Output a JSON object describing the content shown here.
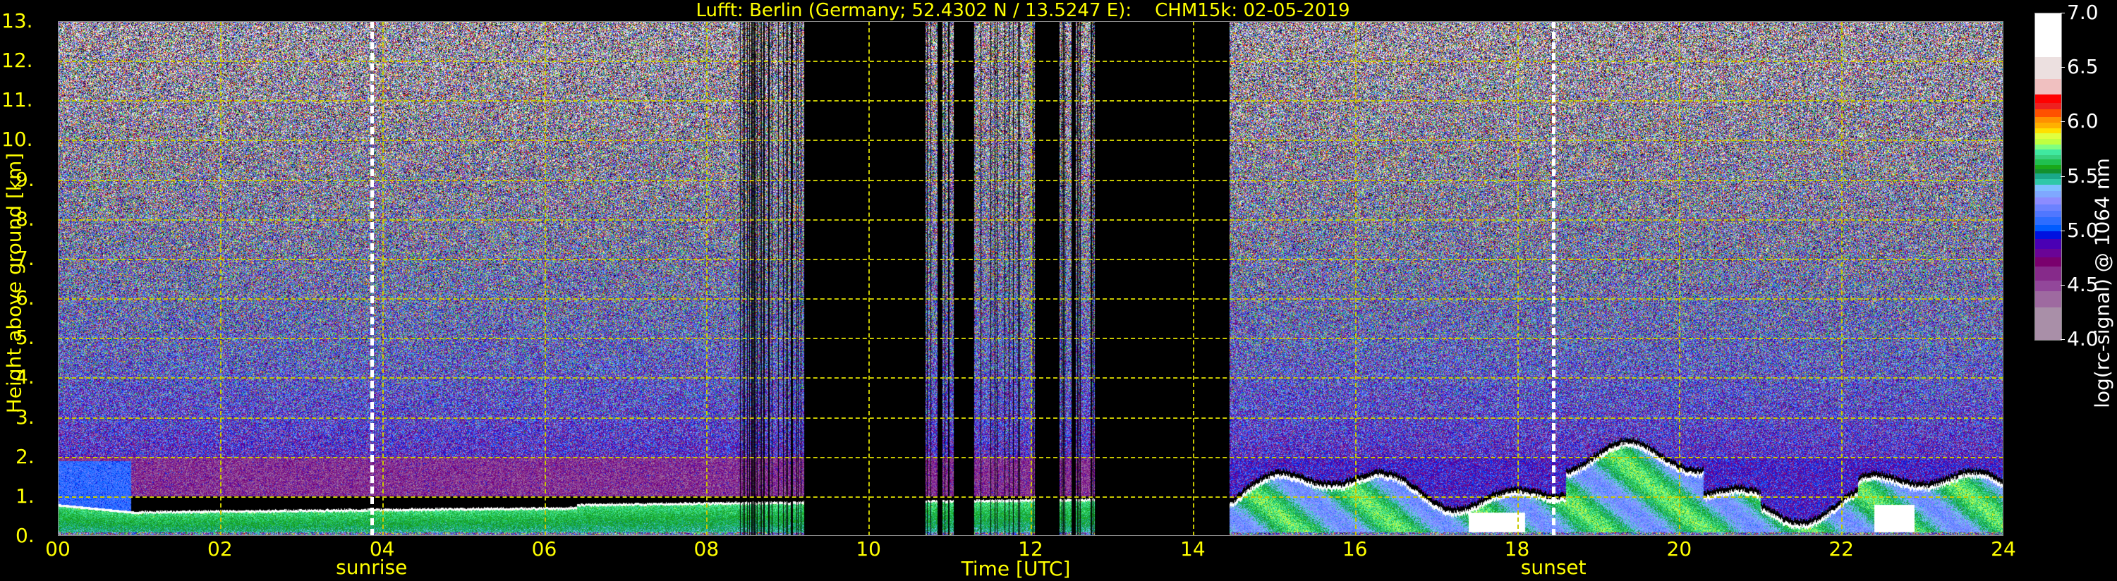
{
  "chart_data": {
    "type": "heatmap",
    "title": "Lufft: Berlin (Germany; 52.4302 N / 13.5247 E):    CHM15k: 02-05-2019",
    "xlabel": "Time [UTC]",
    "ylabel": "Height above ground [km]",
    "xlim": [
      0,
      24
    ],
    "ylim": [
      0,
      13
    ],
    "grid": true,
    "xticks": [
      {
        "value": 0,
        "label": "00"
      },
      {
        "value": 2,
        "label": "02"
      },
      {
        "value": 4,
        "label": "04"
      },
      {
        "value": 6,
        "label": "06"
      },
      {
        "value": 8,
        "label": "08"
      },
      {
        "value": 10,
        "label": "10"
      },
      {
        "value": 12,
        "label": "12"
      },
      {
        "value": 14,
        "label": "14"
      },
      {
        "value": 16,
        "label": "16"
      },
      {
        "value": 18,
        "label": "18"
      },
      {
        "value": 20,
        "label": "20"
      },
      {
        "value": 22,
        "label": "22"
      },
      {
        "value": 24,
        "label": "24"
      }
    ],
    "yticks": [
      {
        "value": 0,
        "label": "0."
      },
      {
        "value": 1,
        "label": "1."
      },
      {
        "value": 2,
        "label": "2."
      },
      {
        "value": 3,
        "label": "3."
      },
      {
        "value": 4,
        "label": "4."
      },
      {
        "value": 5,
        "label": "5."
      },
      {
        "value": 6,
        "label": "6."
      },
      {
        "value": 7,
        "label": "7."
      },
      {
        "value": 8,
        "label": "8."
      },
      {
        "value": 9,
        "label": "9."
      },
      {
        "value": 10,
        "label": "10."
      },
      {
        "value": 11,
        "label": "11."
      },
      {
        "value": 12,
        "label": "12."
      },
      {
        "value": 13,
        "label": "13."
      }
    ],
    "annotations": [
      {
        "label": "sunrise",
        "time": 3.87
      },
      {
        "label": "sunset",
        "time": 18.45
      }
    ],
    "missing_data_intervals": [
      [
        9.2,
        10.7
      ],
      [
        10.85,
        10.9
      ],
      [
        11.05,
        11.3
      ],
      [
        12.05,
        12.35
      ],
      [
        12.5,
        12.55
      ],
      [
        12.8,
        14.45
      ]
    ],
    "colorbar": {
      "label": "log(rc-signal) @ 1064 nm",
      "range": [
        4.0,
        7.0
      ],
      "ticks": [
        {
          "value": 4.0,
          "label": "4.0"
        },
        {
          "value": 4.5,
          "label": "4.5"
        },
        {
          "value": 5.0,
          "label": "5.0"
        },
        {
          "value": 5.5,
          "label": "5.5"
        },
        {
          "value": 6.0,
          "label": "6.0"
        },
        {
          "value": 6.5,
          "label": "6.5"
        },
        {
          "value": 7.0,
          "label": "7.0"
        }
      ],
      "levels": [
        {
          "from": 4.0,
          "to": 4.3,
          "color": "#a98fa8"
        },
        {
          "from": 4.3,
          "to": 4.45,
          "color": "#9e6aa0"
        },
        {
          "from": 4.45,
          "to": 4.55,
          "color": "#92479a"
        },
        {
          "from": 4.55,
          "to": 4.68,
          "color": "#862a8a"
        },
        {
          "from": 4.68,
          "to": 4.76,
          "color": "#7a006e"
        },
        {
          "from": 4.76,
          "to": 4.84,
          "color": "#6a0496"
        },
        {
          "from": 4.84,
          "to": 4.93,
          "color": "#4a00b4"
        },
        {
          "from": 4.93,
          "to": 5.0,
          "color": "#0012e0"
        },
        {
          "from": 5.0,
          "to": 5.06,
          "color": "#005cff"
        },
        {
          "from": 5.06,
          "to": 5.13,
          "color": "#2d6dff"
        },
        {
          "from": 5.13,
          "to": 5.19,
          "color": "#5077ff"
        },
        {
          "from": 5.19,
          "to": 5.25,
          "color": "#6b82ff"
        },
        {
          "from": 5.25,
          "to": 5.31,
          "color": "#8c8cff"
        },
        {
          "from": 5.31,
          "to": 5.37,
          "color": "#7fa8ff"
        },
        {
          "from": 5.37,
          "to": 5.43,
          "color": "#80c0ff"
        },
        {
          "from": 5.43,
          "to": 5.48,
          "color": "#30c8a8"
        },
        {
          "from": 5.48,
          "to": 5.53,
          "color": "#1aa88a"
        },
        {
          "from": 5.53,
          "to": 5.57,
          "color": "#12902e"
        },
        {
          "from": 5.57,
          "to": 5.61,
          "color": "#1aa81a"
        },
        {
          "from": 5.61,
          "to": 5.66,
          "color": "#20c050"
        },
        {
          "from": 5.66,
          "to": 5.7,
          "color": "#38d080"
        },
        {
          "from": 5.7,
          "to": 5.75,
          "color": "#40e8a0"
        },
        {
          "from": 5.75,
          "to": 5.8,
          "color": "#80ff80"
        },
        {
          "from": 5.8,
          "to": 5.85,
          "color": "#c0ff40"
        },
        {
          "from": 5.85,
          "to": 5.9,
          "color": "#e0ff40"
        },
        {
          "from": 5.9,
          "to": 5.95,
          "color": "#ffe000"
        },
        {
          "from": 5.95,
          "to": 6.0,
          "color": "#ffb000"
        },
        {
          "from": 6.0,
          "to": 6.05,
          "color": "#ff9000"
        },
        {
          "from": 6.05,
          "to": 6.12,
          "color": "#ff5000"
        },
        {
          "from": 6.12,
          "to": 6.18,
          "color": "#ee2020"
        },
        {
          "from": 6.18,
          "to": 6.26,
          "color": "#ff0000"
        },
        {
          "from": 6.26,
          "to": 6.4,
          "color": "#f0c0c0"
        },
        {
          "from": 6.4,
          "to": 6.6,
          "color": "#ece0e0"
        },
        {
          "from": 6.6,
          "to": 7.0,
          "color": "#ffffff"
        }
      ]
    }
  }
}
